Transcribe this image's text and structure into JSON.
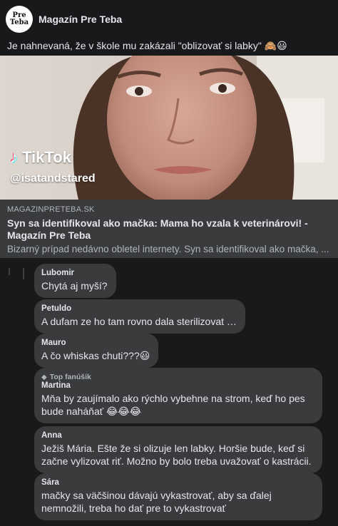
{
  "post": {
    "page_name": "Magazín Pre Teba",
    "avatar_line1": "Pre",
    "avatar_line2": "Teba",
    "text": "Je nahnevaná, že v škole mu zakázali \"oblizovať si labky\" 🙈😃"
  },
  "media": {
    "watermark_logo": "TikTok",
    "watermark_handle": "@isatandstared"
  },
  "link": {
    "domain": "MAGAZINPRETEBA.SK",
    "title": "Syn sa identifikoval ako mačka: Mama ho vzala k veterinárovi! - Magazín Pre Teba",
    "description": "Bizarný prípad nedávno obletel internety. Syn sa identifikoval ako mačka, ..."
  },
  "comments": [
    {
      "author": "Lubomir",
      "text": "Chytá aj myší?"
    },
    {
      "author": "Petuldo",
      "text": "A dufam ze ho tam rovno dala sterilizovat …"
    },
    {
      "author": "Mauro",
      "text": "A čo whiskas chuti???😃"
    },
    {
      "author": "Martina",
      "badge": "Top fanúšik",
      "badge_icon": "diamond-icon",
      "text": "Mňa by zaujímalo ako rýchlo vybehne na strom, keď ho pes bude naháňať 😂😂😂"
    },
    {
      "author": "Anna",
      "text": "Ježiš Mária. Ešte že si olizuje len labky. Horšie bude, keď si začne vylizovat riť. Možno by bolo treba uvažovať o kastrácii."
    },
    {
      "author": "Sára",
      "text": "mačky sa väčšinou dávajú vykastrovať, aby sa ďalej nemnožili, treba ho dať pre to vykastrovať"
    }
  ],
  "colors": {
    "background": "#18191a",
    "bubble": "#3a3b3c",
    "text": "#e4e6eb",
    "secondary_text": "#b0b3b8"
  }
}
